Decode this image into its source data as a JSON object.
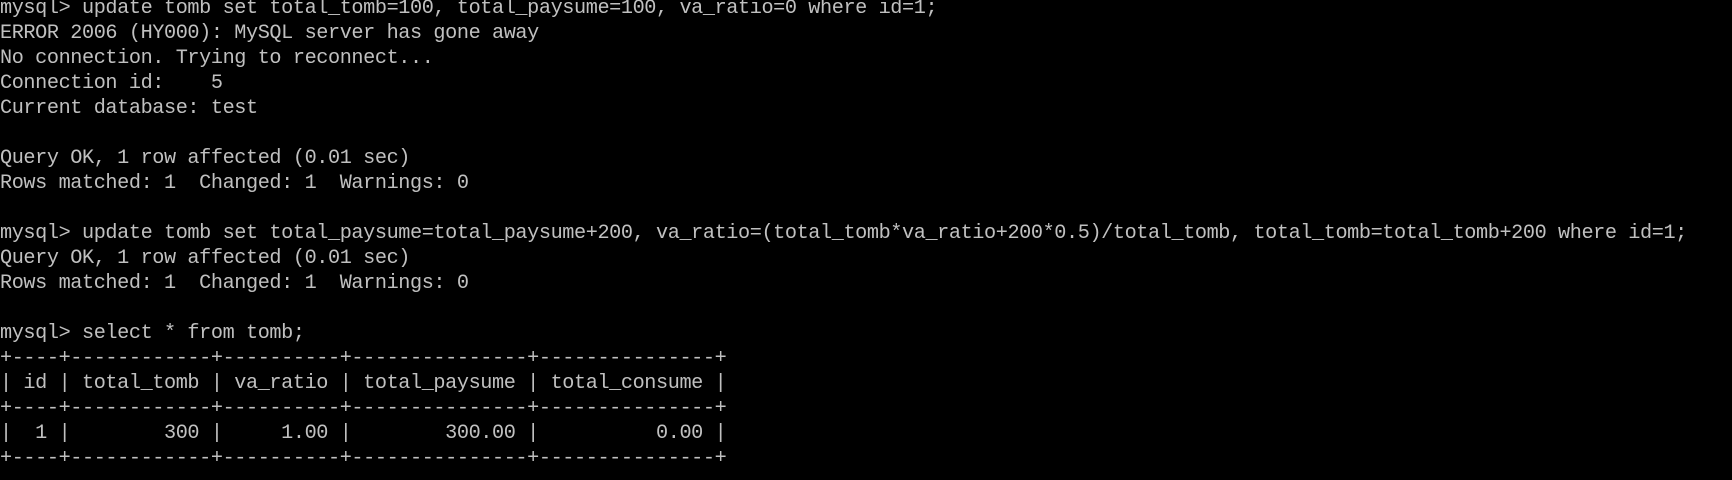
{
  "terminal": {
    "background": "#000000",
    "foreground": "#c0c0c0",
    "lines": [
      "mysql> update tomb set total_tomb=100, total_paysume=100, va_ratio=0 where id=1;",
      "ERROR 2006 (HY000): MySQL server has gone away",
      "No connection. Trying to reconnect...",
      "Connection id:    5",
      "Current database: test",
      "",
      "Query OK, 1 row affected (0.01 sec)",
      "Rows matched: 1  Changed: 1  Warnings: 0",
      "",
      "mysql> update tomb set total_paysume=total_paysume+200, va_ratio=(total_tomb*va_ratio+200*0.5)/total_tomb, total_tomb=total_tomb+200 where id=1;",
      "Query OK, 1 row affected (0.01 sec)",
      "Rows matched: 1  Changed: 1  Warnings: 0",
      "",
      "mysql> select * from tomb;",
      "+----+------------+----------+---------------+---------------+",
      "| id | total_tomb | va_ratio | total_paysume | total_consume |",
      "+----+------------+----------+---------------+---------------+",
      "|  1 |        300 |     1.00 |        300.00 |          0.00 |",
      "+----+------------+----------+---------------+---------------+"
    ]
  }
}
